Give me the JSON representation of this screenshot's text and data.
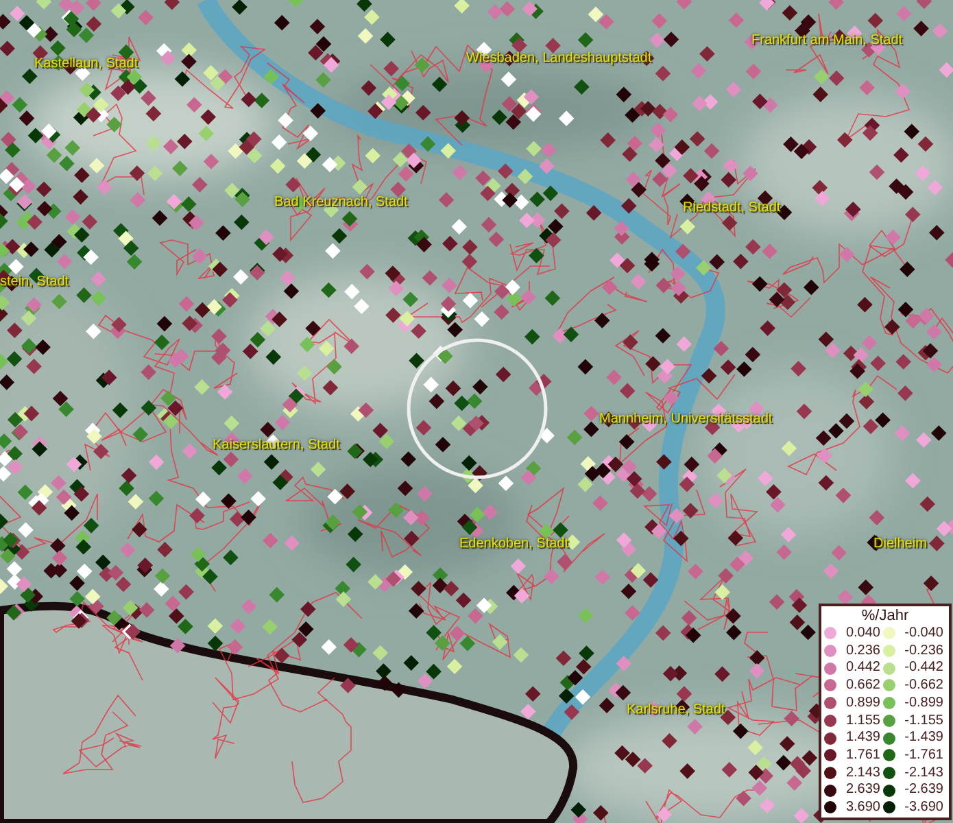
{
  "map": {
    "labels": [
      {
        "text": "Kastellaun, Stadt"
      },
      {
        "text": "Wiesbaden, Landeshauptstadt"
      },
      {
        "text": "Frankfurt am Main, Stadt"
      },
      {
        "text": "Bad Kreuznach, Stadt"
      },
      {
        "text": "Riedstadt, Stadt"
      },
      {
        "text": "stein, Stadt"
      },
      {
        "text": "Kaiserslautern, Stadt"
      },
      {
        "text": "Mannheim, Universitätsstadt"
      },
      {
        "text": "Edenkoben, Stadt"
      },
      {
        "text": "Dielheim"
      },
      {
        "text": "Karlsruhe, Stadt"
      }
    ]
  },
  "legend": {
    "title": "%/Jahr",
    "rows": [
      {
        "positive": {
          "value": "0.040",
          "color": "#f0a8d8"
        },
        "negative": {
          "value": "-0.040",
          "color": "#f0f8c0"
        }
      },
      {
        "positive": {
          "value": "0.236",
          "color": "#e090c0"
        },
        "negative": {
          "value": "-0.236",
          "color": "#d8f0a0"
        }
      },
      {
        "positive": {
          "value": "0.442",
          "color": "#d078a8"
        },
        "negative": {
          "value": "-0.442",
          "color": "#b8e090"
        }
      },
      {
        "positive": {
          "value": "0.662",
          "color": "#c86890"
        },
        "negative": {
          "value": "-0.662",
          "color": "#98d070"
        }
      },
      {
        "positive": {
          "value": "0.899",
          "color": "#b05070"
        },
        "negative": {
          "value": "-0.899",
          "color": "#78c058"
        }
      },
      {
        "positive": {
          "value": "1.155",
          "color": "#983850"
        },
        "negative": {
          "value": "-1.155",
          "color": "#58a040"
        }
      },
      {
        "positive": {
          "value": "1.439",
          "color": "#802838"
        },
        "negative": {
          "value": "-1.439",
          "color": "#388830"
        }
      },
      {
        "positive": {
          "value": "1.761",
          "color": "#681828"
        },
        "negative": {
          "value": "-1.761",
          "color": "#206818"
        }
      },
      {
        "positive": {
          "value": "2.143",
          "color": "#501018"
        },
        "negative": {
          "value": "-2.143",
          "color": "#105010"
        }
      },
      {
        "positive": {
          "value": "2.639",
          "color": "#380810"
        },
        "negative": {
          "value": "-2.639",
          "color": "#083808"
        }
      },
      {
        "positive": {
          "value": "3.690",
          "color": "#200408"
        },
        "negative": {
          "value": "-3.690",
          "color": "#042004"
        }
      }
    ]
  }
}
